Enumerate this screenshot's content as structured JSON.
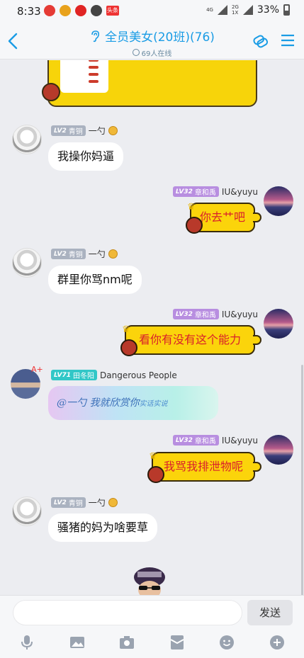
{
  "status_bar": {
    "time": "8:33",
    "battery": "33%",
    "network_top": "4G",
    "network_bottom": "2G",
    "network_sub": "1X",
    "toutiao": "头条"
  },
  "header": {
    "title": "全员美女(20班)(76)",
    "online": "69人在线"
  },
  "messages": [
    {
      "level": "LV2",
      "rank": "青铜",
      "name": "一勺",
      "text": "我操你妈逼"
    },
    {
      "level": "LV32",
      "rank": "章和禹",
      "name": "IU&yuyu",
      "text": "你去艹吧"
    },
    {
      "level": "LV2",
      "rank": "青铜",
      "name": "一勺",
      "text": "群里你骂nm呢"
    },
    {
      "level": "LV32",
      "rank": "章和禹",
      "name": "IU&yuyu",
      "text": "看你有没有这个能力"
    },
    {
      "level": "LV71",
      "rank": "田冬阳",
      "name": "Dangerous People",
      "text": "@一勺 我就欣赏你",
      "text_small": "实话实说"
    },
    {
      "level": "LV32",
      "rank": "章和禹",
      "name": "IU&yuyu",
      "text": "我骂我排泄物呢"
    },
    {
      "level": "LV2",
      "rank": "青铜",
      "name": "一勺",
      "text": "骚猪的妈为啥要草"
    }
  ],
  "input": {
    "send_label": "发送",
    "placeholder": ""
  },
  "icons": [
    "back-icon",
    "ear-icon",
    "share-icon",
    "menu-icon",
    "mic-icon",
    "image-icon",
    "camera-icon",
    "red-packet-icon",
    "emoji-icon",
    "plus-icon"
  ]
}
